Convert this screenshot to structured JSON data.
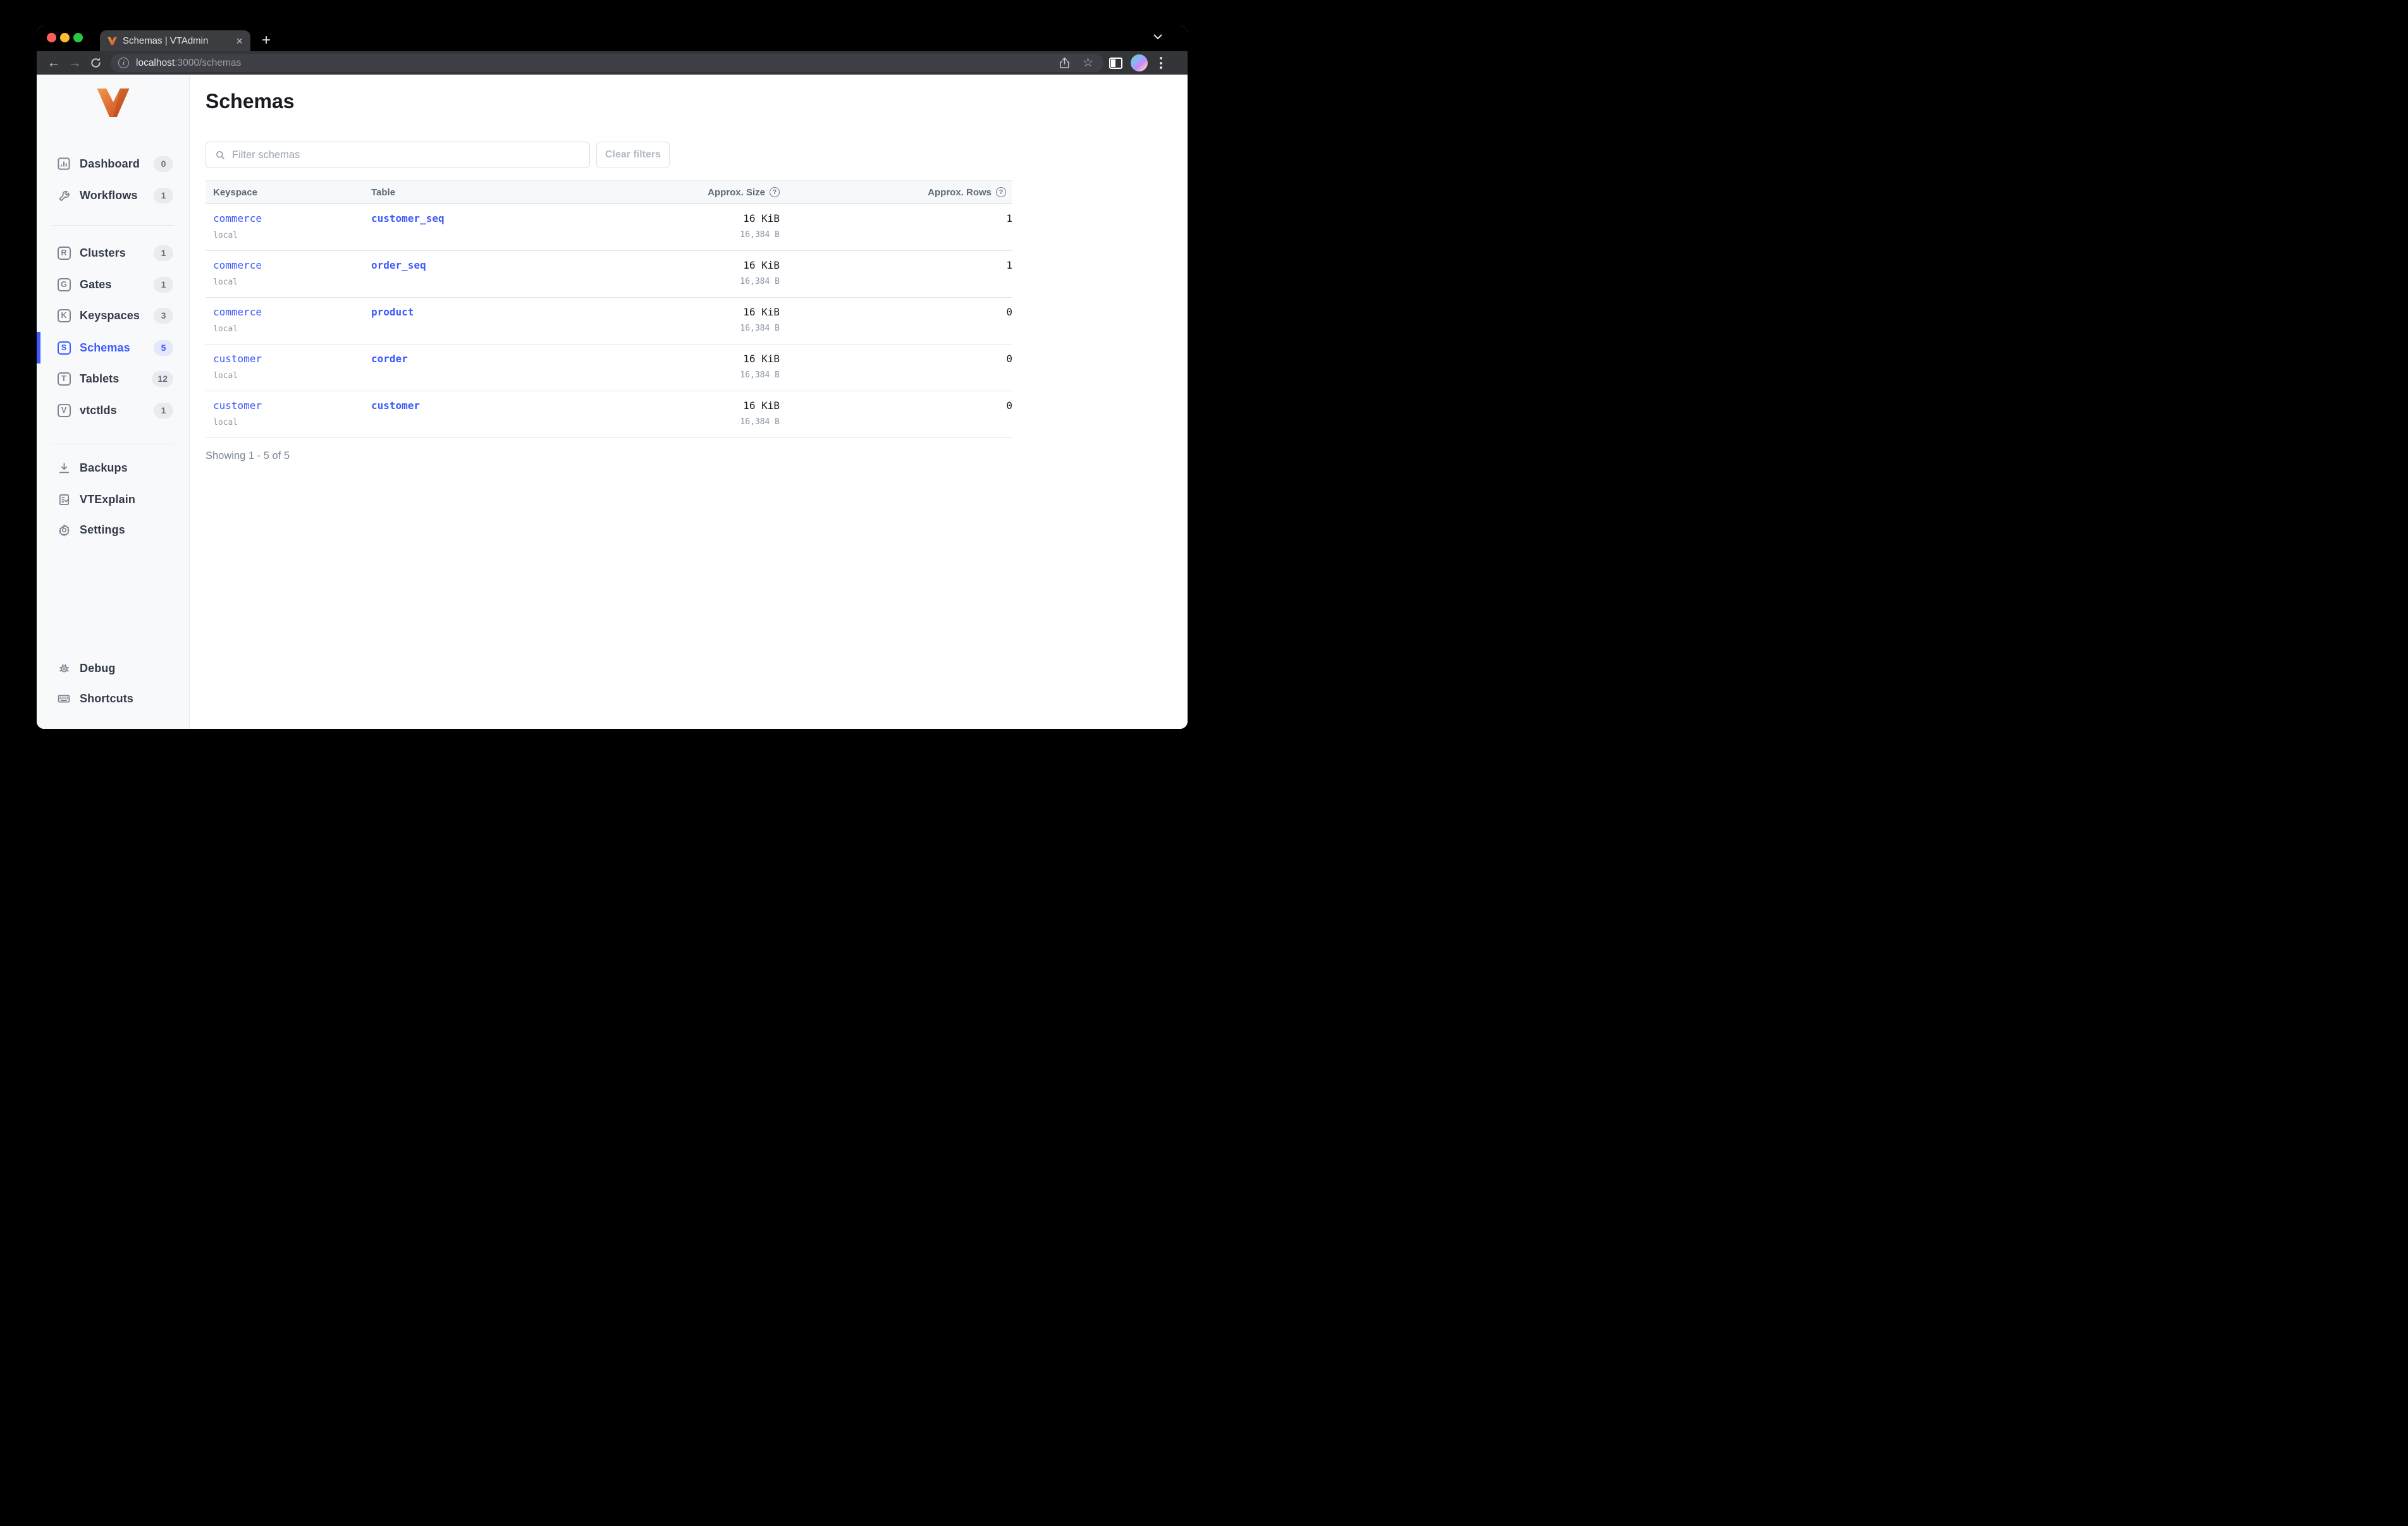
{
  "browser": {
    "tab": {
      "title": "Schemas | VTAdmin",
      "close_glyph": "×"
    },
    "new_tab_glyph": "+",
    "nav": {
      "back_glyph": "←",
      "forward_glyph": "→"
    },
    "url": {
      "host": "localhost",
      "rest": ":3000/schemas",
      "info_glyph": "i"
    },
    "star_glyph": "☆"
  },
  "sidebar": {
    "items": [
      {
        "label": "Dashboard",
        "badge": "0"
      },
      {
        "label": "Workflows",
        "badge": "1"
      },
      {
        "label": "Clusters",
        "badge": "1",
        "letter": "R"
      },
      {
        "label": "Gates",
        "badge": "1",
        "letter": "G"
      },
      {
        "label": "Keyspaces",
        "badge": "3",
        "letter": "K"
      },
      {
        "label": "Schemas",
        "badge": "5",
        "letter": "S"
      },
      {
        "label": "Tablets",
        "badge": "12",
        "letter": "T"
      },
      {
        "label": "vtctlds",
        "badge": "1",
        "letter": "V"
      },
      {
        "label": "Backups"
      },
      {
        "label": "VTExplain"
      },
      {
        "label": "Settings"
      },
      {
        "label": "Debug"
      },
      {
        "label": "Shortcuts"
      }
    ]
  },
  "main": {
    "title": "Schemas",
    "filter": {
      "placeholder": "Filter schemas",
      "clear_label": "Clear filters"
    },
    "table": {
      "columns": [
        "Keyspace",
        "Table",
        "Approx. Size",
        "Approx. Rows"
      ],
      "help_glyph": "?",
      "rows": [
        {
          "keyspace": "commerce",
          "cluster": "local",
          "table": "customer_seq",
          "size": "16 KiB",
          "size_bytes": "16,384 B",
          "row_count": "1"
        },
        {
          "keyspace": "commerce",
          "cluster": "local",
          "table": "order_seq",
          "size": "16 KiB",
          "size_bytes": "16,384 B",
          "row_count": "1"
        },
        {
          "keyspace": "commerce",
          "cluster": "local",
          "table": "product",
          "size": "16 KiB",
          "size_bytes": "16,384 B",
          "row_count": "0"
        },
        {
          "keyspace": "customer",
          "cluster": "local",
          "table": "corder",
          "size": "16 KiB",
          "size_bytes": "16,384 B",
          "row_count": "0"
        },
        {
          "keyspace": "customer",
          "cluster": "local",
          "table": "customer",
          "size": "16 KiB",
          "size_bytes": "16,384 B",
          "row_count": "0"
        }
      ],
      "summary": "Showing 1 - 5 of 5"
    }
  },
  "colors": {
    "accent": "#3d5afe",
    "logo_orange": "#e8702a",
    "traffic_red": "#ff5f57",
    "traffic_yellow": "#febc2e",
    "traffic_green": "#28c840"
  }
}
